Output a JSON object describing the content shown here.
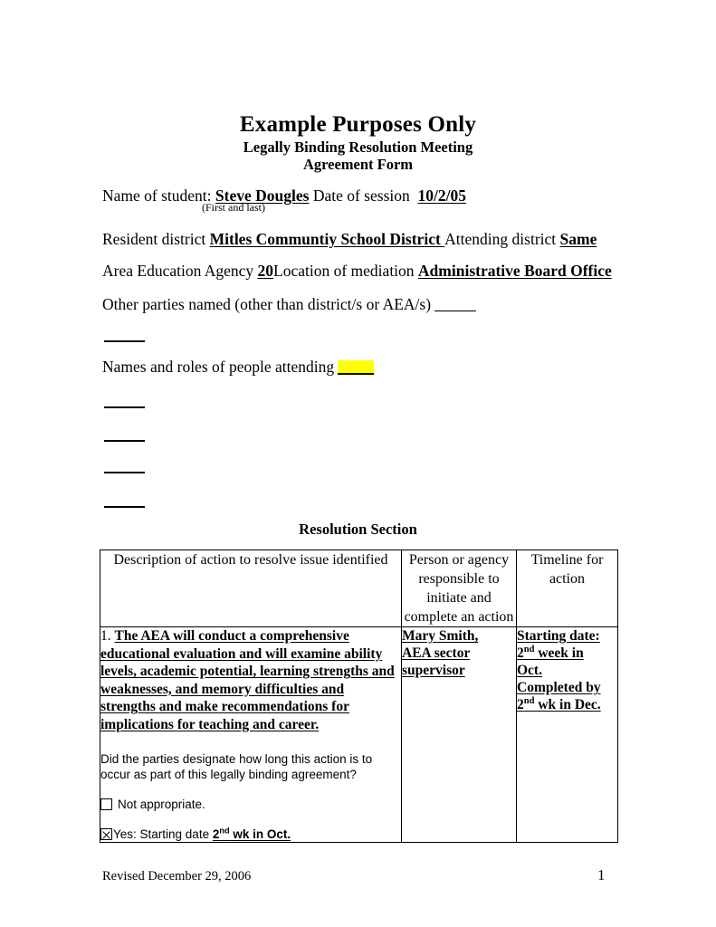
{
  "document": {
    "title": "Example Purposes Only",
    "subtitle_line_1": "Legally Binding Resolution Meeting",
    "subtitle_line_2": "Agreement Form"
  },
  "form": {
    "student_label": "Name of student:",
    "student_value": "Steve Dougles",
    "date_label": "Date of session",
    "date_value": "10/2/05",
    "name_hint": "(First and last)",
    "resident_district_label": "Resident district",
    "resident_district_value": "Mitles Communtiy School District ",
    "attending_district_label": "Attending district",
    "attending_district_value": "Same",
    "aea_label": "Area Education Agency",
    "aea_value": "20",
    "location_label": "Location of mediation",
    "location_value": "Administrative Board Office",
    "other_parties_label": "Other parties named (other than district/s or AEA/s)",
    "attendees_label": "Names and roles of people attending",
    "attendees_value": "",
    "highlight_color": "#FFFF00"
  },
  "resolution": {
    "heading": "Resolution Section",
    "columns": [
      "Description of action to resolve issue identified",
      "Person or agency responsible to initiate and complete an action",
      "Timeline for action"
    ],
    "row": {
      "number": "1.",
      "action_text": "The AEA will conduct a comprehensive educational evaluation and will examine ability levels, academic potential, learning strengths and weaknesses, and memory difficulties and strengths and make recommendations for implications for teaching and career.",
      "question": "Did the parties designate how long this action is to occur as part of this legally binding agreement?",
      "option_not_appropriate": {
        "label": "Not appropriate.",
        "checked": false
      },
      "option_yes": {
        "prefix": "Yes: Starting date",
        "value_num": "2",
        "value_sup": "nd",
        "value_rest": " wk in Oct.",
        "checked": true
      },
      "person_line_1": "Mary Smith,",
      "person_line_2": "AEA sector",
      "person_line_3": "supervisor",
      "timeline_line_1": "Starting date:",
      "timeline_line_2_num": "2",
      "timeline_line_2_sup": "nd",
      "timeline_line_2_rest": " week in",
      "timeline_line_3": "Oct.",
      "timeline_line_4": "Completed by",
      "timeline_line_5_num": "2",
      "timeline_line_5_sup": "nd",
      "timeline_line_5_rest": " wk in Dec."
    }
  },
  "footer": {
    "revised": "Revised December 29, 2006",
    "page_number": "1"
  }
}
